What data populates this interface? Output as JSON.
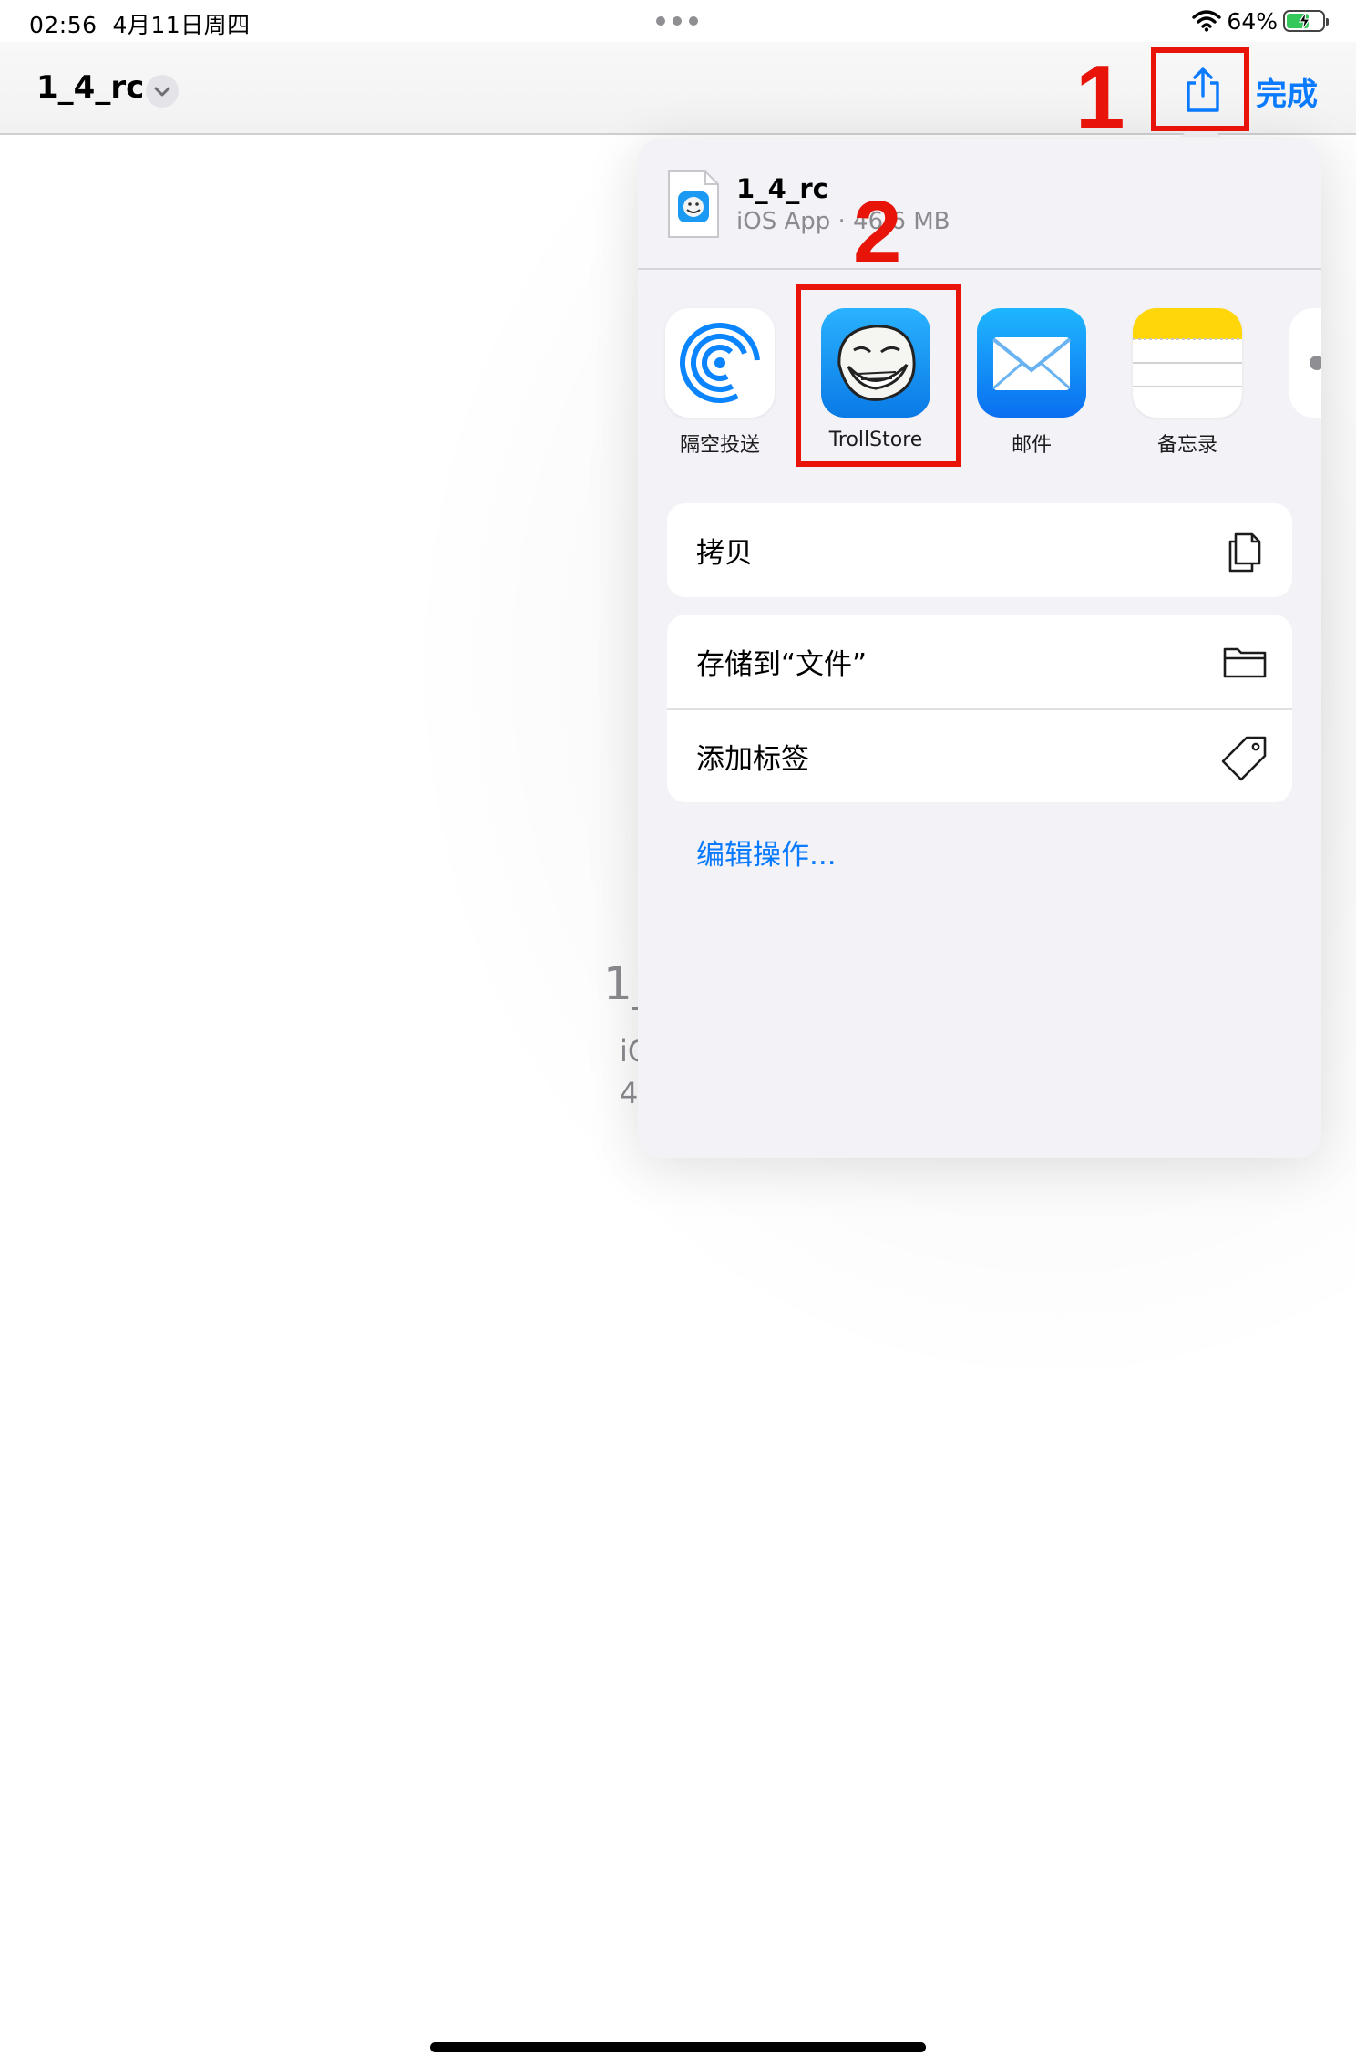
{
  "status_bar": {
    "time": "02:56",
    "date": "4月11日周四",
    "battery_percent": "64%",
    "battery_level": 0.64,
    "charging": true
  },
  "nav": {
    "title": "1_4_rc",
    "done_label": "完成"
  },
  "preview": {
    "name": "1_",
    "kind": "iC",
    "size": "4"
  },
  "share_sheet": {
    "file": {
      "name": "1_4_rc",
      "meta": "iOS App · 46.6 MB"
    },
    "apps": [
      {
        "label": "隔空投送",
        "icon": "airdrop-icon"
      },
      {
        "label": "TrollStore",
        "icon": "trollstore-icon"
      },
      {
        "label": "邮件",
        "icon": "mail-icon"
      },
      {
        "label": "备忘录",
        "icon": "notes-icon"
      }
    ],
    "actions_group1": [
      {
        "label": "拷贝",
        "icon": "copy-icon"
      }
    ],
    "actions_group2": [
      {
        "label": "存储到“文件”",
        "icon": "folder-icon"
      },
      {
        "label": "添加标签",
        "icon": "tag-icon"
      }
    ],
    "edit_actions_label": "编辑操作..."
  },
  "annotations": {
    "step1": "1",
    "step2": "2",
    "color": "#e8140a"
  },
  "colors": {
    "accent": "#0a7aff",
    "sheet_bg": "#f2f2f7"
  }
}
